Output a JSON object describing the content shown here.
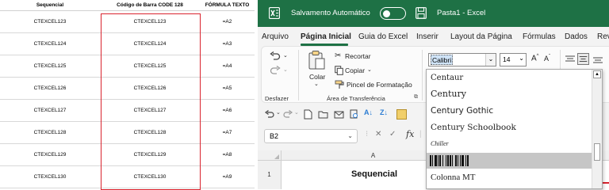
{
  "sheet": {
    "headers": [
      "Sequencial",
      "Código de Barra CODE 128",
      "FÓRMULA TEXTO"
    ],
    "rows": [
      [
        "CTEXCEL123",
        "CTEXCEL123",
        "=A2"
      ],
      [
        "CTEXCEL124",
        "CTEXCEL124",
        "=A3"
      ],
      [
        "CTEXCEL125",
        "CTEXCEL125",
        "=A4"
      ],
      [
        "CTEXCEL126",
        "CTEXCEL126",
        "=A5"
      ],
      [
        "CTEXCEL127",
        "CTEXCEL127",
        "=A6"
      ],
      [
        "CTEXCEL128",
        "CTEXCEL128",
        "=A7"
      ],
      [
        "CTEXCEL129",
        "CTEXCEL129",
        "=A8"
      ],
      [
        "CTEXCEL130",
        "CTEXCEL130",
        "=A9"
      ]
    ],
    "highlight_color": "#d9232e"
  },
  "excel": {
    "autosave_label": "Salvamento Automático",
    "autosave_state": "off",
    "doc_title": "Pasta1 - Excel",
    "brand_color": "#1e7145",
    "menu_tabs": [
      "Arquivo",
      "Página Inicial",
      "Guia do Excel",
      "Inserir",
      "Layout da Página",
      "Fórmulas",
      "Dados",
      "Rev"
    ],
    "active_tab": "Página Inicial",
    "ribbon": {
      "undo_group": "Desfazer",
      "paste_label": "Colar",
      "cut_label": "Recortar",
      "copy_label": "Copiar",
      "format_painter_label": "Pincel de Formatação",
      "clipboard_group": "Área de Transferência",
      "font_name": "Calibri",
      "font_size": "14"
    },
    "name_box": "B2",
    "formula_equals": "=",
    "column_header": "A",
    "row_header": "1",
    "cell_a1": "Sequencial",
    "font_list": [
      "Centaur",
      "Century",
      "Century Gothic",
      "Century Schoolbook",
      "Chiller",
      "Code 128",
      "Colonna MT"
    ],
    "selected_font": "Code 128"
  },
  "icons": {
    "excel_logo": "excel-logo-icon",
    "save": "save-icon",
    "undo": "undo-icon",
    "redo": "redo-icon",
    "paste": "paste-icon",
    "cut": "scissors-icon",
    "copy": "copy-icon",
    "format_painter": "paintbrush-icon",
    "sort_asc": "sort-ascending-icon",
    "sort_desc": "sort-descending-icon"
  }
}
